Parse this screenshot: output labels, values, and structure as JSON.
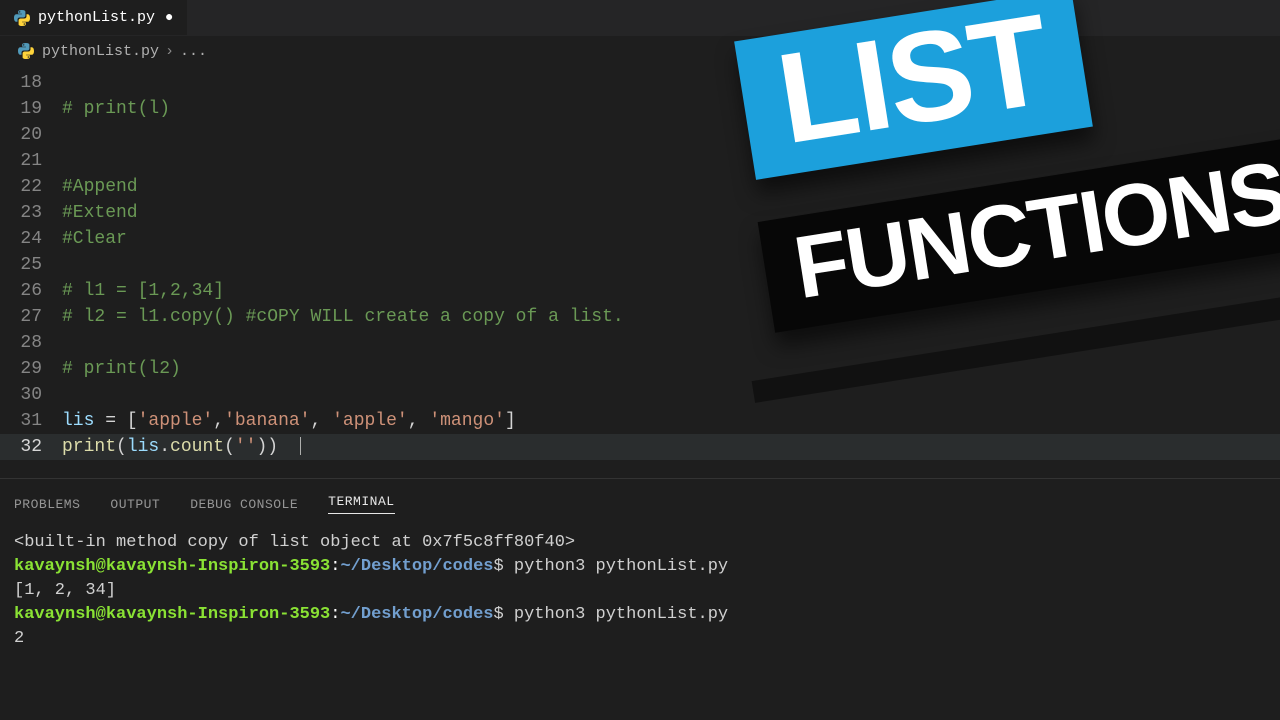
{
  "tab": {
    "filename": "pythonList.py",
    "modified": true
  },
  "breadcrumb": {
    "filename": "pythonList.py",
    "more": "..."
  },
  "editor": {
    "lines": [
      {
        "n": 18,
        "tokens": []
      },
      {
        "n": 19,
        "tokens": [
          {
            "c": "comment",
            "t": "# print(l)"
          }
        ]
      },
      {
        "n": 20,
        "tokens": []
      },
      {
        "n": 21,
        "tokens": []
      },
      {
        "n": 22,
        "tokens": [
          {
            "c": "comment",
            "t": "#Append"
          }
        ]
      },
      {
        "n": 23,
        "tokens": [
          {
            "c": "comment",
            "t": "#Extend"
          }
        ]
      },
      {
        "n": 24,
        "tokens": [
          {
            "c": "comment",
            "t": "#Clear"
          }
        ]
      },
      {
        "n": 25,
        "tokens": []
      },
      {
        "n": 26,
        "tokens": [
          {
            "c": "comment",
            "t": "# l1 = [1,2,34]"
          }
        ]
      },
      {
        "n": 27,
        "tokens": [
          {
            "c": "comment",
            "t": "# l2 = l1.copy() #cOPY WILL create a copy of a list."
          }
        ]
      },
      {
        "n": 28,
        "tokens": []
      },
      {
        "n": 29,
        "tokens": [
          {
            "c": "comment",
            "t": "# print(l2)"
          }
        ]
      },
      {
        "n": 30,
        "tokens": []
      },
      {
        "n": 31,
        "tokens": [
          {
            "c": "var",
            "t": "lis"
          },
          {
            "c": "punct",
            "t": " = ["
          },
          {
            "c": "string",
            "t": "'apple'"
          },
          {
            "c": "punct",
            "t": ","
          },
          {
            "c": "string",
            "t": "'banana'"
          },
          {
            "c": "punct",
            "t": ", "
          },
          {
            "c": "string",
            "t": "'apple'"
          },
          {
            "c": "punct",
            "t": ", "
          },
          {
            "c": "string",
            "t": "'mango'"
          },
          {
            "c": "punct",
            "t": "]"
          }
        ]
      },
      {
        "n": 32,
        "active": true,
        "tokens": [
          {
            "c": "funcbi",
            "t": "print"
          },
          {
            "c": "punct",
            "t": "("
          },
          {
            "c": "var",
            "t": "lis"
          },
          {
            "c": "punct",
            "t": "."
          },
          {
            "c": "func",
            "t": "count"
          },
          {
            "c": "punct",
            "t": "("
          },
          {
            "c": "string",
            "t": "''"
          },
          {
            "c": "punct",
            "t": "))"
          }
        ]
      }
    ]
  },
  "panel": {
    "tabs": [
      "PROBLEMS",
      "OUTPUT",
      "DEBUG CONSOLE",
      "TERMINAL"
    ],
    "active_tab": "TERMINAL"
  },
  "terminal": {
    "user": "kavaynsh@kavaynsh-Inspiron-3593",
    "path": "~/Desktop/codes",
    "prompt_cmd": "python3 pythonList.py",
    "output_builtin": "<built-in method copy of list object at 0x7f5c8ff80f40>",
    "output_list": "[1, 2, 34]",
    "output_last": "2"
  },
  "overlay": {
    "banner1": "LIST",
    "banner2": "FUNCTIONS"
  },
  "colors": {
    "banner1_bg": "#1ca0dc",
    "banner2_bg": "#070707"
  }
}
